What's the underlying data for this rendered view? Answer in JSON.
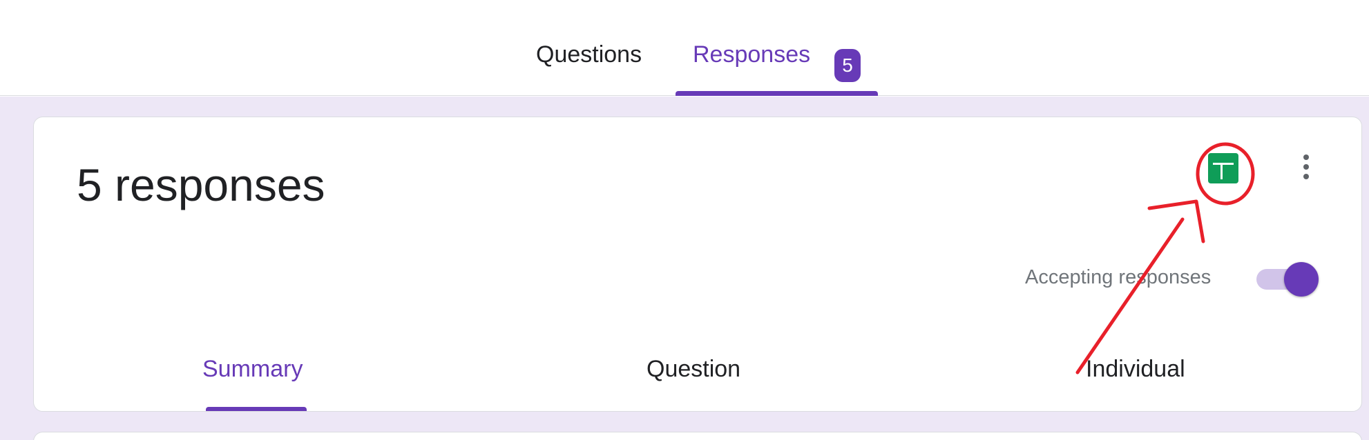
{
  "tabs": {
    "questions_label": "Questions",
    "responses_label": "Responses",
    "responses_count": "5"
  },
  "summary": {
    "title": "5 responses",
    "accepting_label": "Accepting responses",
    "accepting_enabled": true
  },
  "sub_tabs": {
    "summary_label": "Summary",
    "question_label": "Question",
    "individual_label": "Individual"
  },
  "icons": {
    "sheets": "google-sheets-icon",
    "more": "more-vert-icon"
  },
  "colors": {
    "accent": "#673ab7",
    "background": "#ede7f6",
    "sheets_green": "#0f9d58",
    "annotation_red": "#e8202a"
  }
}
